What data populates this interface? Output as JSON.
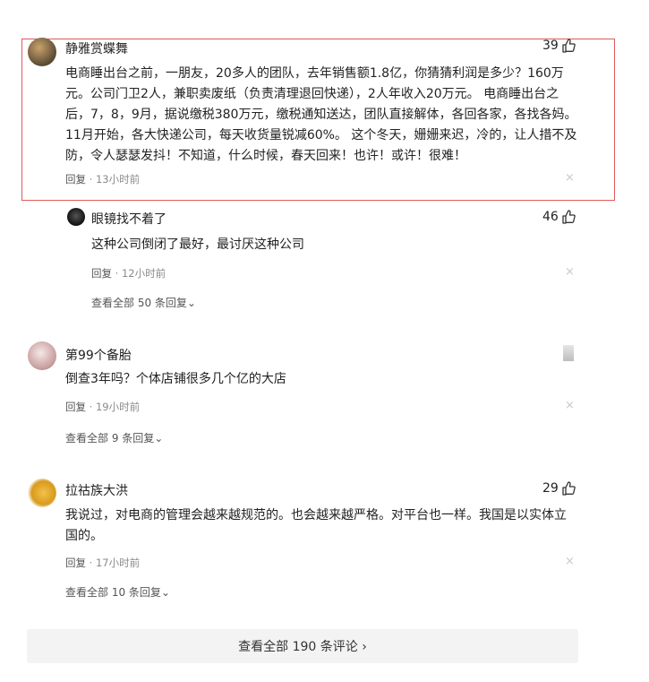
{
  "comments": [
    {
      "username": "静雅赏蝶舞",
      "likes": "39",
      "text": "电商睡出台之前，一朋友，20多人的团队，去年销售额1.8亿，你猜猜利润是多少？160万元。公司门卫2人，兼职卖废纸（负责清理退回快递），2人年收入20万元。 电商睡出台之后，7，8，9月，据说缴税380万元，缴税通知送达，团队直接解体，各回各家，各找各妈。 11月开始，各大快递公司，每天收货量锐减60%。 这个冬天，姗姗来迟，冷的，让人措不及防，令人瑟瑟发抖！不知道，什么时候，春天回来！也许！或许！很难！",
      "reply_label": "回复",
      "time": "13小时前"
    },
    {
      "username": "眼镜找不着了",
      "likes": "46",
      "text": "这种公司倒闭了最好，最讨厌这种公司",
      "reply_label": "回复",
      "time": "12小时前",
      "view_replies": "查看全部 50 条回复"
    },
    {
      "username": "第99个备胎",
      "text": "倒查3年吗？个体店铺很多几个亿的大店",
      "reply_label": "回复",
      "time": "19小时前",
      "view_replies": "查看全部 9 条回复"
    },
    {
      "username": "拉祜族大洪",
      "likes": "29",
      "text": "我说过，对电商的管理会越来越规范的。也会越来越严格。对平台也一样。我国是以实体立国的。",
      "reply_label": "回复",
      "time": "17小时前",
      "view_replies": "查看全部 10 条回复"
    }
  ],
  "separator": " · ",
  "close_glyph": "×",
  "footer": {
    "view_all_comments": "查看全部 190 条评论 ›"
  },
  "colors": {
    "highlight_border": "#e05a5a",
    "meta_gray": "#8a8a8a"
  }
}
